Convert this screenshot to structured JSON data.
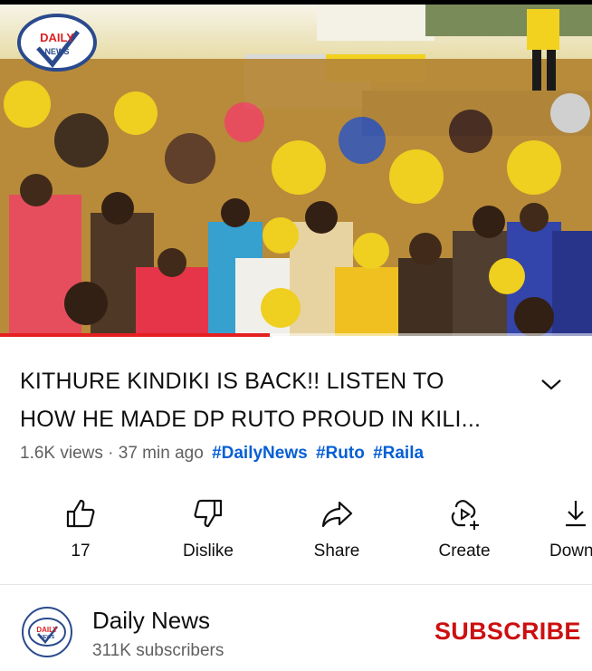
{
  "video": {
    "watermark_text": "DAILY NEWS",
    "progress_fraction": 0.455
  },
  "title": {
    "line1": "KITHURE KINDIKI IS BACK!! LISTEN TO",
    "line2": "HOW HE MADE DP RUTO PROUD IN KILI..."
  },
  "meta": {
    "views": "1.6K views",
    "separator": "·",
    "age": "37 min ago",
    "tags": [
      "#DailyNews",
      "#Ruto",
      "#Raila"
    ]
  },
  "actions": {
    "like_count": "17",
    "dislike": "Dislike",
    "share": "Share",
    "create": "Create",
    "download": "Down"
  },
  "channel": {
    "name": "Daily News",
    "subscribers": "311K subscribers",
    "subscribe_label": "SUBSCRIBE",
    "avatar_text": "DAILY NEWS"
  },
  "colors": {
    "accent_red": "#cc1010",
    "link_blue": "#065fd4",
    "progress_red": "#e52020",
    "crowd_yellow": "#f2d21e"
  },
  "icons": [
    "like-icon",
    "dislike-icon",
    "share-icon",
    "create-icon",
    "download-icon",
    "chevron-down-icon"
  ]
}
